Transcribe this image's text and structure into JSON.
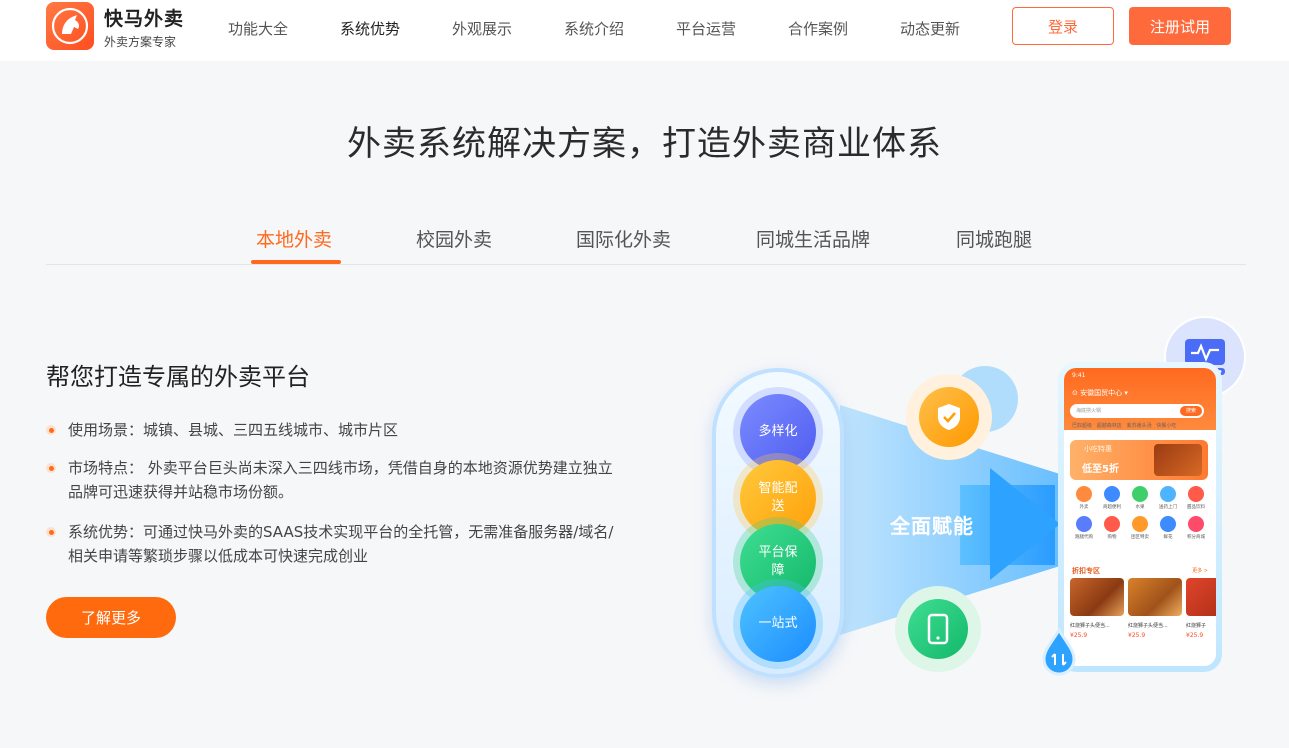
{
  "brand": {
    "name": "快马外卖",
    "tagline": "外卖方案专家"
  },
  "nav": [
    "功能大全",
    "系统优势",
    "外观展示",
    "系统介绍",
    "平台运营",
    "合作案例",
    "动态更新"
  ],
  "nav_active_index": 1,
  "header_buttons": {
    "login": "登录",
    "register": "注册试用"
  },
  "hero_title": "外卖系统解决方案，打造外卖商业体系",
  "tabs": [
    "本地外卖",
    "校园外卖",
    "国际化外卖",
    "同城生活品牌",
    "同城跑腿"
  ],
  "tab_active_index": 0,
  "section": {
    "title": "帮您打造专属的外卖平台",
    "bullets": [
      "使用场景：城镇、县城、三四五线城市、城市片区",
      "市场特点： 外卖平台巨头尚未深入三四线市场，凭借自身的本地资源优势建立独立品牌可迅速获得并站稳市场份额。",
      "系统优势：可通过快马外卖的SAAS技术实现平台的全托管，无需准备服务器/域名/相关申请等繁琐步骤以低成本可快速完成创业"
    ],
    "cta": "了解更多"
  },
  "illustration": {
    "circles": [
      "多样化",
      "智能配送",
      "平台保障",
      "一站式"
    ],
    "beam_text": "全面赋能",
    "phone": {
      "time": "9:41",
      "location": "安徽国贸中心",
      "search_placeholder": "海底捞火锅",
      "search_button": "搜索",
      "tags": [
        "巴奴超级",
        "超越森林店",
        "紫苏番头汤",
        "快餐小吃"
      ],
      "banner_sub": "小吃特惠",
      "banner_title": "低至5折",
      "categories": [
        "外卖",
        "商超便利",
        "水果",
        "送药上门",
        "甜品饮料",
        "跑腿代购",
        "购物",
        "团区特卖",
        "鲜花",
        "积分商城"
      ],
      "discount_title": "折扣专区",
      "more": "更多 >",
      "items": [
        {
          "name": "红烧狮子头便当...",
          "price": "¥25.9"
        },
        {
          "name": "红烧狮子头便当...",
          "price": "¥25.9"
        },
        {
          "name": "红烧狮子",
          "price": "¥25.9"
        }
      ]
    }
  },
  "colors": {
    "accent": "#ff6a1f",
    "blue": "#2ea2ff"
  }
}
